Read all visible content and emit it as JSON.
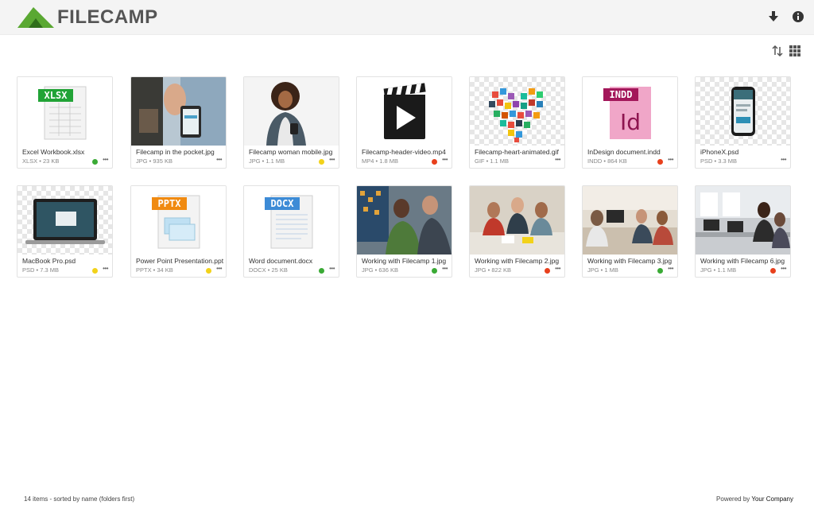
{
  "header": {
    "brand": "FILECAMP",
    "download_icon": "download-icon",
    "info_icon": "info-icon"
  },
  "toolbar": {
    "sort_icon": "sort-icon",
    "grid_icon": "grid-view-icon"
  },
  "files": [
    {
      "name": "Excel Workbook.xlsx",
      "meta": "XLSX • 23 KB",
      "status": "#3aaa35",
      "thumb": "xlsx"
    },
    {
      "name": "Filecamp in the pocket.jpg",
      "meta": "JPG • 935 KB",
      "status": "",
      "thumb": "photo-pocket"
    },
    {
      "name": "Filecamp woman mobile.jpg",
      "meta": "JPG • 1.1 MB",
      "status": "#f2d21a",
      "thumb": "photo-woman"
    },
    {
      "name": "Filecamp-header-video.mp4",
      "meta": "MP4 • 1.8 MB",
      "status": "#e8401c",
      "thumb": "video"
    },
    {
      "name": "Filecamp-heart-animated.gif",
      "meta": "GIF • 1.1 MB",
      "status": "",
      "thumb": "heart"
    },
    {
      "name": "InDesign document.indd",
      "meta": "INDD • 864 KB",
      "status": "#e8401c",
      "thumb": "indd"
    },
    {
      "name": "iPhoneX.psd",
      "meta": "PSD • 3.3 MB",
      "status": "",
      "thumb": "iphone"
    },
    {
      "name": "MacBook Pro.psd",
      "meta": "PSD • 7.3 MB",
      "status": "#f2d21a",
      "thumb": "macbook"
    },
    {
      "name": "Power Point Presentation.pptx",
      "meta": "PPTX • 34 KB",
      "status": "#f2d21a",
      "thumb": "pptx"
    },
    {
      "name": "Word document.docx",
      "meta": "DOCX • 25 KB",
      "status": "#3aaa35",
      "thumb": "docx"
    },
    {
      "name": "Working with Filecamp 1.jpg",
      "meta": "JPG • 636 KB",
      "status": "#3aaa35",
      "thumb": "photo-work1"
    },
    {
      "name": "Working with Filecamp 2.jpg",
      "meta": "JPG • 822 KB",
      "status": "#e8401c",
      "thumb": "photo-work2"
    },
    {
      "name": "Working with Filecamp 3.jpg",
      "meta": "JPG • 1 MB",
      "status": "#3aaa35",
      "thumb": "photo-work3"
    },
    {
      "name": "Working with Filecamp 6.jpg",
      "meta": "JPG • 1.1 MB",
      "status": "#e8401c",
      "thumb": "photo-work6"
    }
  ],
  "badges": {
    "xlsx": "XLSX",
    "indd": "INDD",
    "pptx": "PPTX",
    "docx": "DOCX"
  },
  "more_label": "•••",
  "footer": {
    "summary": "14 items - sorted by name (folders first)",
    "powered_prefix": "Powered by",
    "powered_company": "Your Company"
  },
  "colors": {
    "brand_green": "#5aa832",
    "status_green": "#3aaa35",
    "status_yellow": "#f2d21a",
    "status_red": "#e8401c"
  }
}
